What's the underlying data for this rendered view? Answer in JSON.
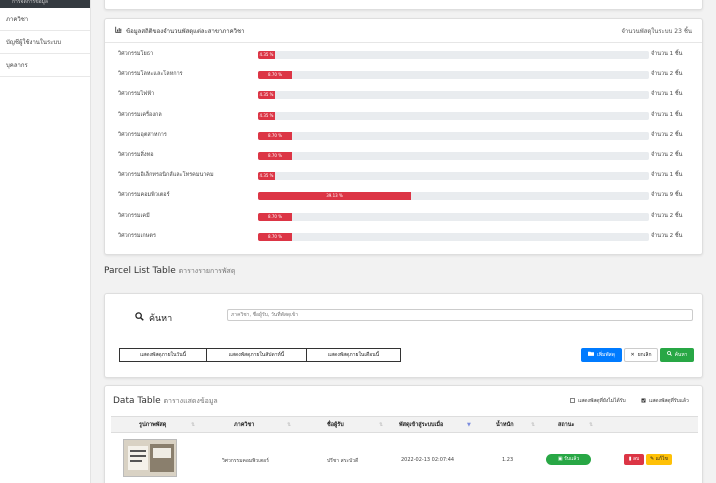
{
  "sidebar": {
    "top_label": "การจัดการข้อมูล",
    "items": [
      {
        "label": "ภาควิชา"
      },
      {
        "label": "บัญชีผู้ใช้งานในระบบ"
      },
      {
        "label": "บุคลากร"
      }
    ]
  },
  "stats": {
    "title": "ข้อมูลสถิติของจำนวนพัสดุแต่ละสาขาภาควิชา",
    "total": "จำนวนพัสดุในระบบ 23 ชิ้น",
    "rows": [
      {
        "label": "วิศวกรรมโยธา",
        "percent_text": "4.35 %",
        "percent": 4.35,
        "count": "จำนวน 1 ชิ้น"
      },
      {
        "label": "วิศวกรรมโลหะและโลหการ",
        "percent_text": "8.70 %",
        "percent": 8.7,
        "count": "จำนวน 2 ชิ้น"
      },
      {
        "label": "วิศวกรรมไฟฟ้า",
        "percent_text": "4.35 %",
        "percent": 4.35,
        "count": "จำนวน 1 ชิ้น"
      },
      {
        "label": "วิศวกรรมเครื่องกล",
        "percent_text": "4.35 %",
        "percent": 4.35,
        "count": "จำนวน 1 ชิ้น"
      },
      {
        "label": "วิศวกรรมอุตสาหการ",
        "percent_text": "8.70 %",
        "percent": 8.7,
        "count": "จำนวน 2 ชิ้น"
      },
      {
        "label": "วิศวกรรมสิ่งทอ",
        "percent_text": "8.70 %",
        "percent": 8.7,
        "count": "จำนวน 2 ชิ้น"
      },
      {
        "label": "วิศวกรรมอิเล็กทรอนิกส์และโทรคมนาคม",
        "percent_text": "4.35 %",
        "percent": 4.35,
        "count": "จำนวน 1 ชิ้น"
      },
      {
        "label": "วิศวกรรมคอมพิวเตอร์",
        "percent_text": "39.13 %",
        "percent": 39.13,
        "count": "จำนวน 9 ชิ้น"
      },
      {
        "label": "วิศวกรรมเคมี",
        "percent_text": "8.70 %",
        "percent": 8.7,
        "count": "จำนวน 2 ชิ้น"
      },
      {
        "label": "วิศวกรรมเกษตร",
        "percent_text": "8.70 %",
        "percent": 8.7,
        "count": "จำนวน 2 ชิ้น"
      }
    ]
  },
  "parcel_section": {
    "title": "Parcel List Table",
    "subtitle": "ตารางรายการพัสดุ"
  },
  "search": {
    "label": "ค้นหา",
    "placeholder": "ภาควิชา, ชื่อผู้รับ, วันที่พัสดุเข้า",
    "filters": [
      "แสดงพัสดุภายในวันนี้",
      "แสดงพัสดุภายในสัปดาห์นี้",
      "แสดงพัสดุภายในเดือนนี้"
    ],
    "add_label": "เพิ่มพัสดุ",
    "cancel_label": "ยกเลิก",
    "search_label": "ค้นหา"
  },
  "table": {
    "title": "Data Table",
    "subtitle": "ตารางแสดงข้อมูล",
    "option_not_received": "แสดงพัสดุที่ยังไม่ได้รับ",
    "option_received": "แสดงพัสดุที่รับแล้ว",
    "columns": [
      "รูปภาพพัสดุ",
      "ภาควิชา",
      "ชื่อผู้รับ",
      "พัสดุเข้าสู่ระบบเมื่อ",
      "น้ำหนัก",
      "สถานะ"
    ],
    "rows": [
      {
        "department": "วิศวกรรมคอมพิวเตอร์",
        "recipient": "ปรีชา สระบัวดี",
        "date": "2022-02-13 02:07:44",
        "weight": "1.23",
        "status": "รับแล้ว",
        "delete_label": "ลบ",
        "edit_label": "แก้ไข"
      }
    ]
  },
  "colors": {
    "progress": "#dc3545",
    "primary": "#007bff",
    "success": "#28a745",
    "danger": "#dc3545",
    "warning": "#ffc107"
  }
}
